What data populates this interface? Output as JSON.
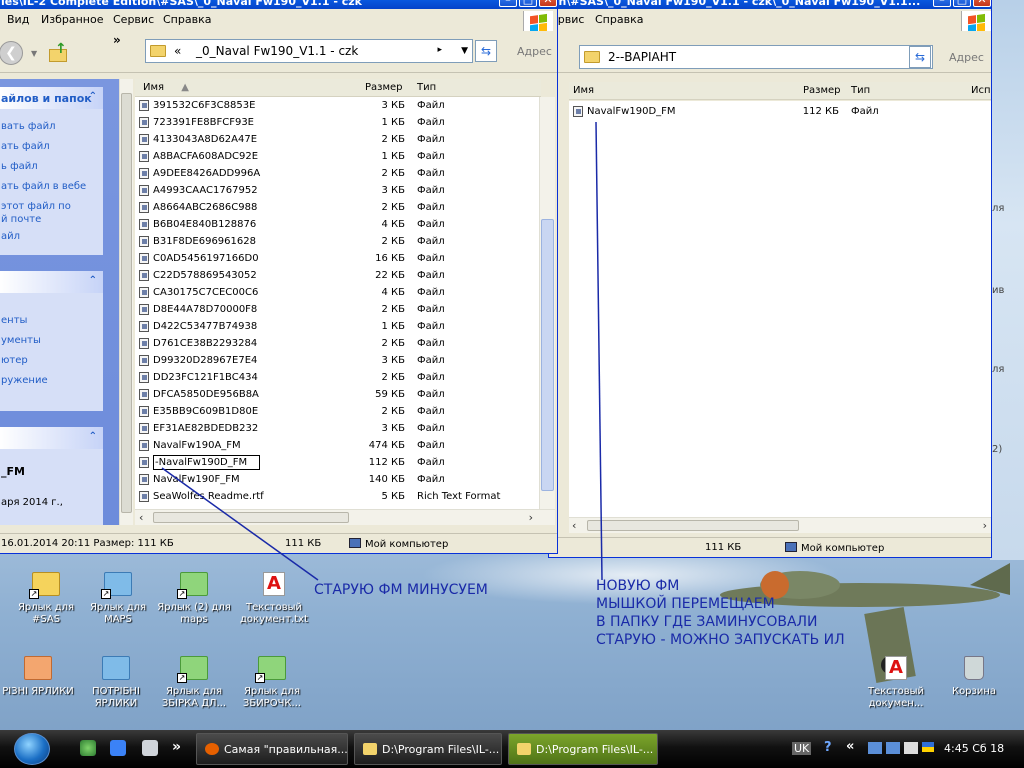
{
  "left_window": {
    "title": "les\\IL-2 Complete Edition\\#SAS\\_0_Naval Fw190_V1.1 - czk",
    "menu": [
      "Вид",
      "Избранное",
      "Сервис",
      "Справка"
    ],
    "address": "_0_Naval Fw190_V1.1 - czk",
    "address_prefix": "«",
    "address_label": "Адрес",
    "columns": {
      "name": "Имя",
      "size": "Размер",
      "type": "Тип"
    },
    "files": [
      {
        "name": "391532C6F3C8853E",
        "size": "3 КБ",
        "type": "Файл"
      },
      {
        "name": "723391FE8BFCF93E",
        "size": "1 КБ",
        "type": "Файл"
      },
      {
        "name": "4133043A8D62A47E",
        "size": "2 КБ",
        "type": "Файл"
      },
      {
        "name": "A8BACFA608ADC92E",
        "size": "1 КБ",
        "type": "Файл"
      },
      {
        "name": "A9DEE8426ADD996A",
        "size": "2 КБ",
        "type": "Файл"
      },
      {
        "name": "A4993CAAC1767952",
        "size": "3 КБ",
        "type": "Файл"
      },
      {
        "name": "A8664ABC2686C988",
        "size": "2 КБ",
        "type": "Файл"
      },
      {
        "name": "B6B04E840B128876",
        "size": "4 КБ",
        "type": "Файл"
      },
      {
        "name": "B31F8DE696961628",
        "size": "2 КБ",
        "type": "Файл"
      },
      {
        "name": "C0AD5456197166D0",
        "size": "16 КБ",
        "type": "Файл"
      },
      {
        "name": "C22D578869543052",
        "size": "22 КБ",
        "type": "Файл"
      },
      {
        "name": "CA30175C7CEC00C6",
        "size": "4 КБ",
        "type": "Файл"
      },
      {
        "name": "D8E44A78D70000F8",
        "size": "2 КБ",
        "type": "Файл"
      },
      {
        "name": "D422C53477B74938",
        "size": "1 КБ",
        "type": "Файл"
      },
      {
        "name": "D761CE38B2293284",
        "size": "2 КБ",
        "type": "Файл"
      },
      {
        "name": "D99320D28967E7E4",
        "size": "3 КБ",
        "type": "Файл"
      },
      {
        "name": "DD23FC121F1BC434",
        "size": "2 КБ",
        "type": "Файл"
      },
      {
        "name": "DFCA5850DE956B8A",
        "size": "59 КБ",
        "type": "Файл"
      },
      {
        "name": "E35BB9C609B1D80E",
        "size": "2 КБ",
        "type": "Файл"
      },
      {
        "name": "EF31AE82BDEDB232",
        "size": "3 КБ",
        "type": "Файл"
      },
      {
        "name": "NavalFw190A_FM",
        "size": "474 КБ",
        "type": "Файл"
      },
      {
        "name": "-NavalFw190D_FM",
        "size": "112 КБ",
        "type": "Файл"
      },
      {
        "name": "NavalFw190F_FM",
        "size": "140 КБ",
        "type": "Файл"
      },
      {
        "name": "SeaWolfes Readme.rtf",
        "size": "5 КБ",
        "type": "Rich Text Format"
      }
    ],
    "sidebar": {
      "section1_title": "айлов и папок",
      "section1_items": [
        "вать файл",
        "ать файл",
        "ь файл",
        "ать файл в вебе",
        "этот файл по",
        "й почте",
        "айл"
      ],
      "section2_items": [
        "енты",
        "ументы",
        "ютер",
        "ружение"
      ],
      "detail_name": "_FM",
      "detail_date": "аря 2014 г.,"
    },
    "status": {
      "info": "16.01.2014 20:11 Размер: 111 КБ",
      "size": "111 КБ",
      "location": "Мой компьютер"
    }
  },
  "right_window": {
    "title": "on\\#SAS\\_0_Naval Fw190_V1.1 - czk\\_0_Naval Fw190_V1.1...",
    "address": "2--ВАРІАНТ",
    "address_label": "Адрес",
    "columns": {
      "name": "Имя",
      "size": "Размер",
      "type": "Тип",
      "extra": "Исп"
    },
    "files": [
      {
        "name": "NavalFw190D_FM",
        "size": "112 КБ",
        "type": "Файл"
      }
    ],
    "status": {
      "size": "111 КБ",
      "location": "Мой компьютер"
    }
  },
  "desktop_strip_text": [
    "ля",
    "ив",
    "ля",
    "2)"
  ],
  "desktop_icons": [
    {
      "label": "Ярлык для #SAS"
    },
    {
      "label": "Ярлык для MAPS"
    },
    {
      "label": "Ярлык (2) для maps"
    },
    {
      "label": "Текстовый документ.txt"
    },
    {
      "label": "РІЗНІ ЯРЛИКИ"
    },
    {
      "label": "ПОТРІБНІ ЯРЛИКИ"
    },
    {
      "label": "Ярлык для ЗБІРКА ДЛ..."
    },
    {
      "label": "Ярлык для ЗБИРОЧК..."
    },
    {
      "label": "Текстовый докумен..."
    },
    {
      "label": "Корзина"
    }
  ],
  "annotations": {
    "left": "СТАРУЮ ФМ МИНУСУЕМ",
    "right_lines": [
      "НОВУЮ ФМ",
      "МЫШКОЙ ПЕРЕМЕЩАЕМ",
      "В ПАПКУ ГДЕ ЗАМИНУСОВАЛИ",
      "СТАРУЮ - МОЖНО  ЗАПУСКАТЬ ИЛ"
    ],
    "color": "#1a2aa8"
  },
  "taskbar": {
    "tasks": [
      "Самая \"правильная...",
      "D:\\Program Files\\IL-...",
      "D:\\Program Files\\IL-..."
    ],
    "language": "UK",
    "help": "?",
    "clock": "4:45 Сб 18"
  },
  "icons": {
    "back": "back-arrow-icon",
    "up": "folder-up-icon",
    "go": "refresh-icon",
    "file": "file-icon",
    "start": "windows-start-icon"
  }
}
